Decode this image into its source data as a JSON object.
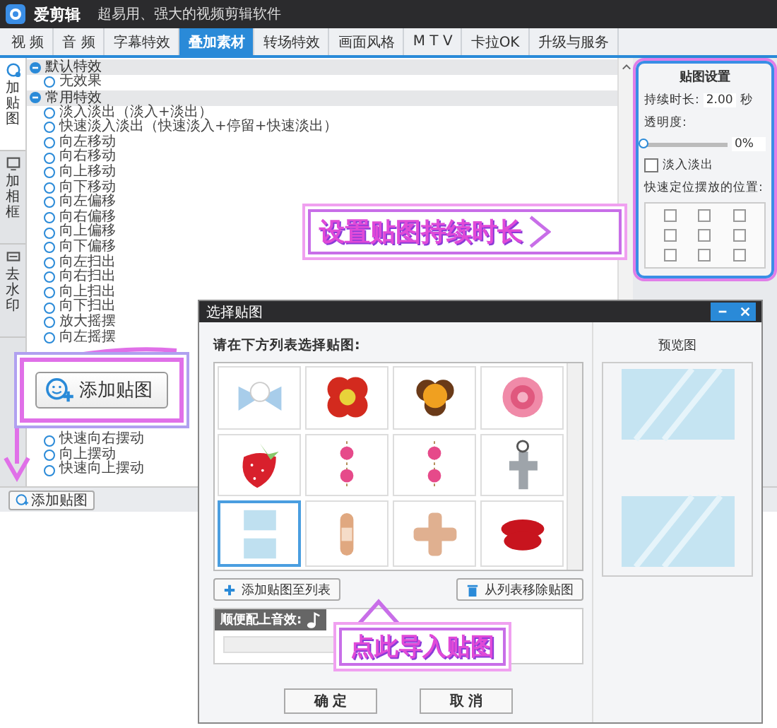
{
  "window": {
    "app_name": "爱剪辑",
    "tagline": "超易用、强大的视频剪辑软件"
  },
  "tabs": [
    {
      "label": "视 频",
      "selected": false
    },
    {
      "label": "音 频",
      "selected": false
    },
    {
      "label": "字幕特效",
      "selected": false
    },
    {
      "label": "叠加素材",
      "selected": true
    },
    {
      "label": "转场特效",
      "selected": false
    },
    {
      "label": "画面风格",
      "selected": false
    },
    {
      "label": "M T V",
      "selected": false
    },
    {
      "label": "卡拉OK",
      "selected": false
    },
    {
      "label": "升级与服务",
      "selected": false
    }
  ],
  "side_tabs": [
    {
      "label": "加贴图",
      "selected": true
    },
    {
      "label": "加相框",
      "selected": false
    },
    {
      "label": "去水印",
      "selected": false
    }
  ],
  "effects": {
    "groups": [
      {
        "title": "默认特效",
        "expanded": true,
        "items": [
          {
            "label": "无效果",
            "selected": false
          }
        ]
      },
      {
        "title": "常用特效",
        "expanded": true,
        "items": [
          {
            "label": "淡入淡出（淡入+淡出）",
            "selected": false
          },
          {
            "label": "快速淡入淡出（快速淡入+停留+快速淡出）",
            "selected": false
          },
          {
            "label": "向左移动",
            "selected": false
          },
          {
            "label": "向右移动",
            "selected": false
          },
          {
            "label": "向上移动",
            "selected": false
          },
          {
            "label": "向下移动",
            "selected": false
          },
          {
            "label": "向左偏移",
            "selected": false
          },
          {
            "label": "向右偏移",
            "selected": false
          },
          {
            "label": "向上偏移",
            "selected": false
          },
          {
            "label": "向下偏移",
            "selected": false
          },
          {
            "label": "向左扫出",
            "selected": false
          },
          {
            "label": "向右扫出",
            "selected": false
          },
          {
            "label": "向上扫出",
            "selected": false
          },
          {
            "label": "向下扫出",
            "selected": false
          },
          {
            "label": "放大摇摆",
            "selected": false
          },
          {
            "label": "向左摇摆",
            "selected": false
          }
        ]
      }
    ],
    "lower_items": [
      {
        "label": "快速向右摆动",
        "selected": false
      },
      {
        "label": "向上摆动",
        "selected": false
      },
      {
        "label": "快速向上摆动",
        "selected": false
      }
    ]
  },
  "add_sticker_button": "添加贴图",
  "settings": {
    "title": "贴图设置",
    "duration_label": "持续时长:",
    "duration_value": "2.00",
    "duration_unit": "秒",
    "opacity_label": "透明度:",
    "opacity": {
      "level": 0,
      "reading": "0%"
    },
    "fade": {
      "label": "淡入淡出",
      "checked": false
    },
    "position_label": "快速定位摆放的位置:",
    "positions": [
      {
        "checked": false
      },
      {
        "checked": false
      },
      {
        "checked": false
      },
      {
        "checked": false
      },
      {
        "checked": false
      },
      {
        "checked": false
      },
      {
        "checked": false
      },
      {
        "checked": false
      },
      {
        "checked": false
      }
    ]
  },
  "annotations": {
    "duration_callout": "设置贴图持续时长",
    "add_callout_button": "添加贴图",
    "import_callout": "点此导入贴图"
  },
  "dialog": {
    "title": "选择贴图",
    "prompt": "请在下方列表选择贴图:",
    "stickers": [
      {
        "kind": "bow",
        "selected": false
      },
      {
        "kind": "flower",
        "selected": false
      },
      {
        "kind": "cookie",
        "selected": false
      },
      {
        "kind": "rose",
        "selected": false
      },
      {
        "kind": "strawberry",
        "selected": false
      },
      {
        "kind": "charm",
        "selected": false
      },
      {
        "kind": "charm",
        "selected": false
      },
      {
        "kind": "cross",
        "selected": false
      },
      {
        "kind": "glass",
        "selected": true
      },
      {
        "kind": "bandage",
        "selected": false
      },
      {
        "kind": "plaster",
        "selected": false
      },
      {
        "kind": "lips",
        "selected": false
      }
    ],
    "add_to_list": "添加贴图至列表",
    "remove_from_list": "从列表移除贴图",
    "sound_label": "顺便配上音效:",
    "ok": "确 定",
    "cancel": "取 消",
    "preview_title": "预览图"
  }
}
